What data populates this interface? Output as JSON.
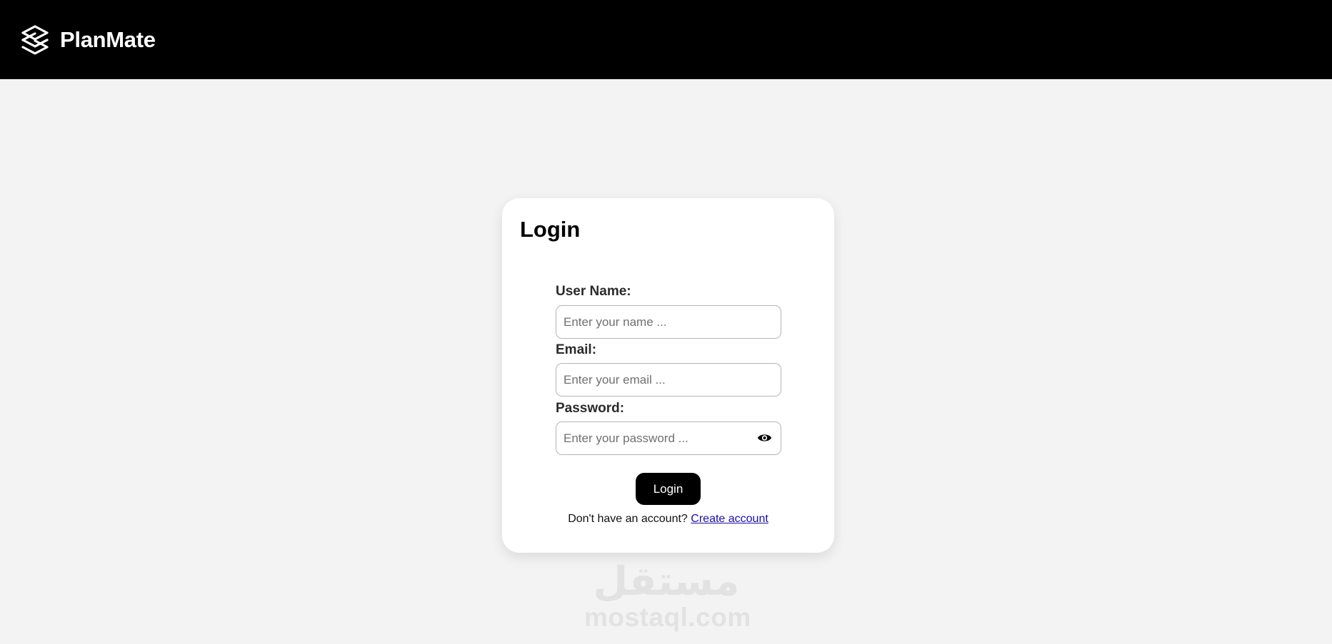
{
  "header": {
    "brand_name": "PlanMate",
    "logo_icon": "stacked-layers-logo-icon",
    "background": "#000000"
  },
  "login": {
    "title": "Login",
    "username_label": "User Name:",
    "username_placeholder": "Enter your name ...",
    "username_value": "",
    "email_label": "Email:",
    "email_placeholder": "Enter your email ...",
    "email_value": "",
    "password_label": "Password:",
    "password_placeholder": "Enter your password ...",
    "password_value": "",
    "password_toggle_icon": "eye-icon",
    "submit_label": "Login",
    "signup_prompt": "Don't have an account?",
    "signup_link": "Create account"
  },
  "watermark": {
    "arabic_text": "مستقل",
    "text": "mostaql.com"
  },
  "colors": {
    "page_background": "#f3f3f3",
    "card_background": "#ffffff",
    "button_background": "#000000",
    "link": "#1a0dab"
  }
}
